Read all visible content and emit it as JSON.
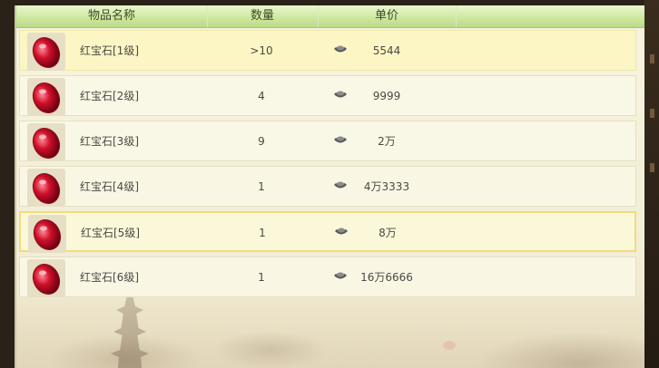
{
  "header": {
    "col_name": "物品名称",
    "col_qty": "数量",
    "col_price": "单价"
  },
  "items": [
    {
      "name": "红宝石[1级]",
      "qty": ">10",
      "price": "5544",
      "icon": "red-gem-icon",
      "currency_icon": "silver-ingot-icon"
    },
    {
      "name": "红宝石[2级]",
      "qty": "4",
      "price": "9999",
      "icon": "red-gem-icon",
      "currency_icon": "silver-ingot-icon"
    },
    {
      "name": "红宝石[3级]",
      "qty": "9",
      "price": "2万",
      "icon": "red-gem-icon",
      "currency_icon": "silver-ingot-icon"
    },
    {
      "name": "红宝石[4级]",
      "qty": "1",
      "price": "4万3333",
      "icon": "red-gem-icon",
      "currency_icon": "silver-ingot-icon"
    },
    {
      "name": "红宝石[5级]",
      "qty": "1",
      "price": "8万",
      "icon": "red-gem-icon",
      "currency_icon": "silver-ingot-icon"
    },
    {
      "name": "红宝石[6级]",
      "qty": "1",
      "price": "16万6666",
      "icon": "red-gem-icon",
      "currency_icon": "silver-ingot-icon"
    }
  ],
  "colors": {
    "header": "#cfe9a0",
    "highlight": "#fbf6c4",
    "selected_border": "#f0dc7a",
    "gem": "#d0102a"
  }
}
